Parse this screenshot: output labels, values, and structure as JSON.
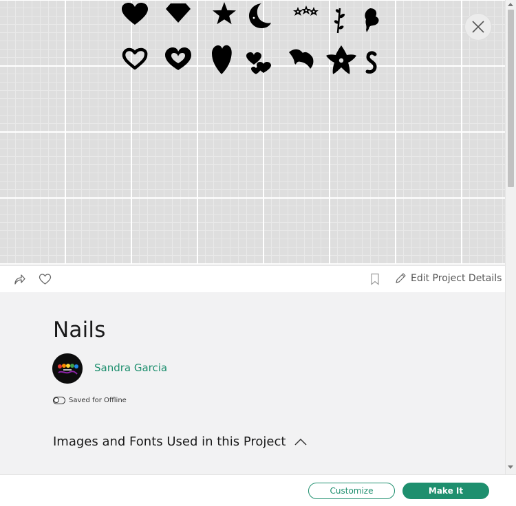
{
  "canvas": {
    "shapes": [
      "heart-icon",
      "diamond-icon",
      "star-icon",
      "moon-icon",
      "stars-icon",
      "leaf-icon",
      "butterfly-icon",
      "heart-outline-icon",
      "heart-outline-bold-icon",
      "heart-tall-icon",
      "hearts-icon",
      "bird-icon",
      "flower-icon",
      "swirl-icon"
    ]
  },
  "actions": {
    "edit_label": "Edit Project Details"
  },
  "project": {
    "title": "Nails",
    "author": "Sandra Garcia",
    "offline_label": "Saved for Offline",
    "images_heading": "Images and Fonts Used in this Project"
  },
  "footer": {
    "customize_label": "Customize",
    "make_label": "Make It"
  },
  "colors": {
    "accent": "#1e8f6e",
    "canvas_bg": "#dedede"
  }
}
